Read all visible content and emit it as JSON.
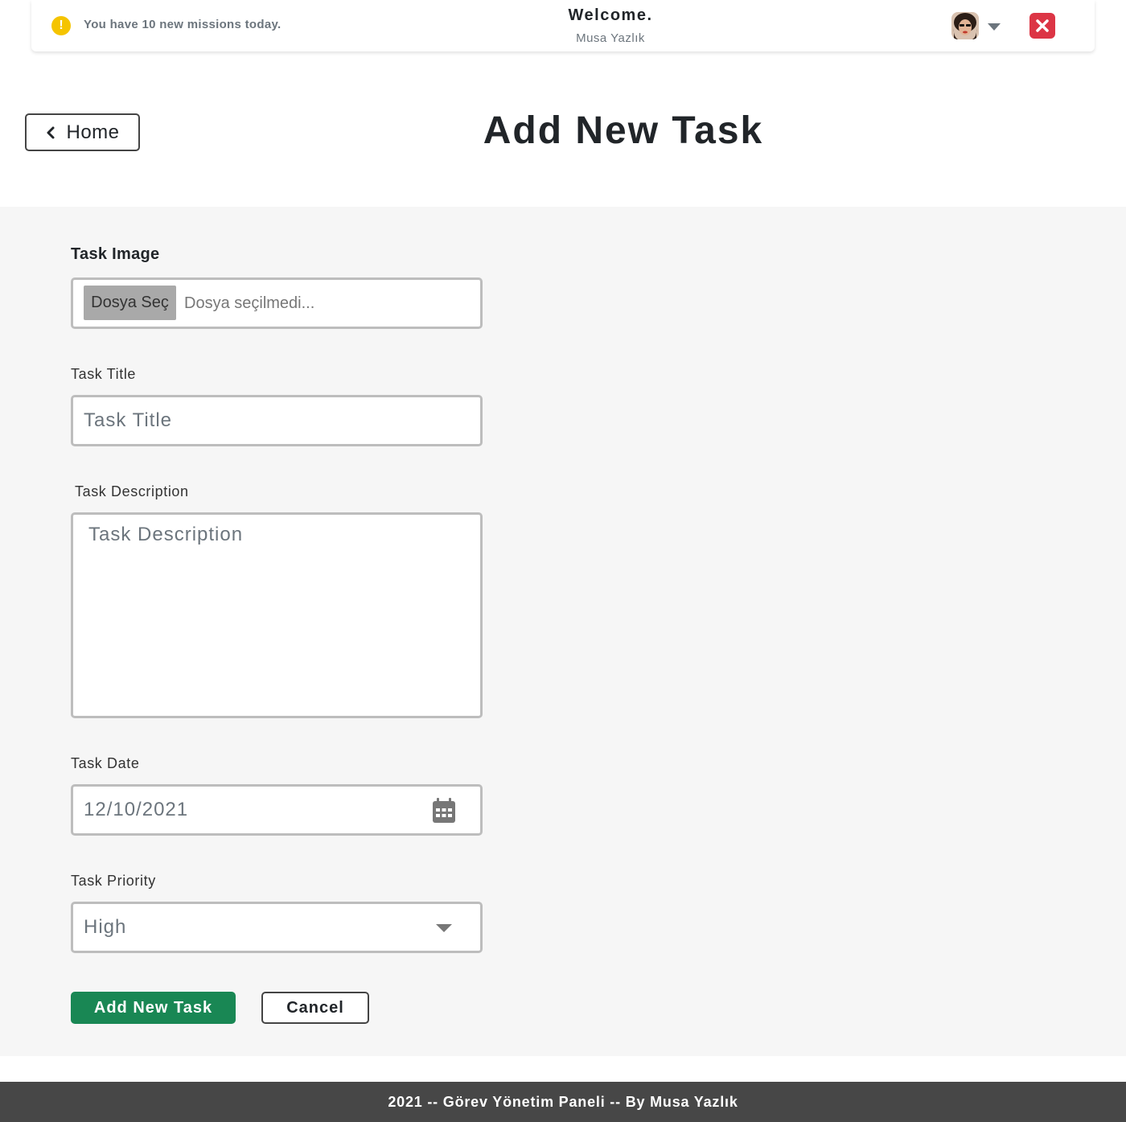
{
  "topbar": {
    "notice_icon": "exclamation-icon",
    "notice_text": "You have 10 new missions today.",
    "welcome_title": "Welcome.",
    "welcome_user": "Musa Yazlık",
    "accent_warning": "#f5c400",
    "accent_danger": "#dc3545"
  },
  "header": {
    "home_label": "Home",
    "page_title": "Add New Task"
  },
  "form": {
    "image_label": "Task Image",
    "file_button_label": "Dosya Seç",
    "file_status": "Dosya seçilmedi...",
    "title_label": "Task Title",
    "title_placeholder": "Task Title",
    "description_label": "Task Description",
    "description_placeholder": "Task Description",
    "date_label": "Task Date",
    "date_value": "12/10/2021",
    "priority_label": "Task Priority",
    "priority_value": "High",
    "submit_label": "Add New Task",
    "cancel_label": "Cancel",
    "submit_color": "#198754"
  },
  "footer": {
    "text": "2021 -- Görev Yönetim Paneli -- By Musa Yazlık"
  }
}
